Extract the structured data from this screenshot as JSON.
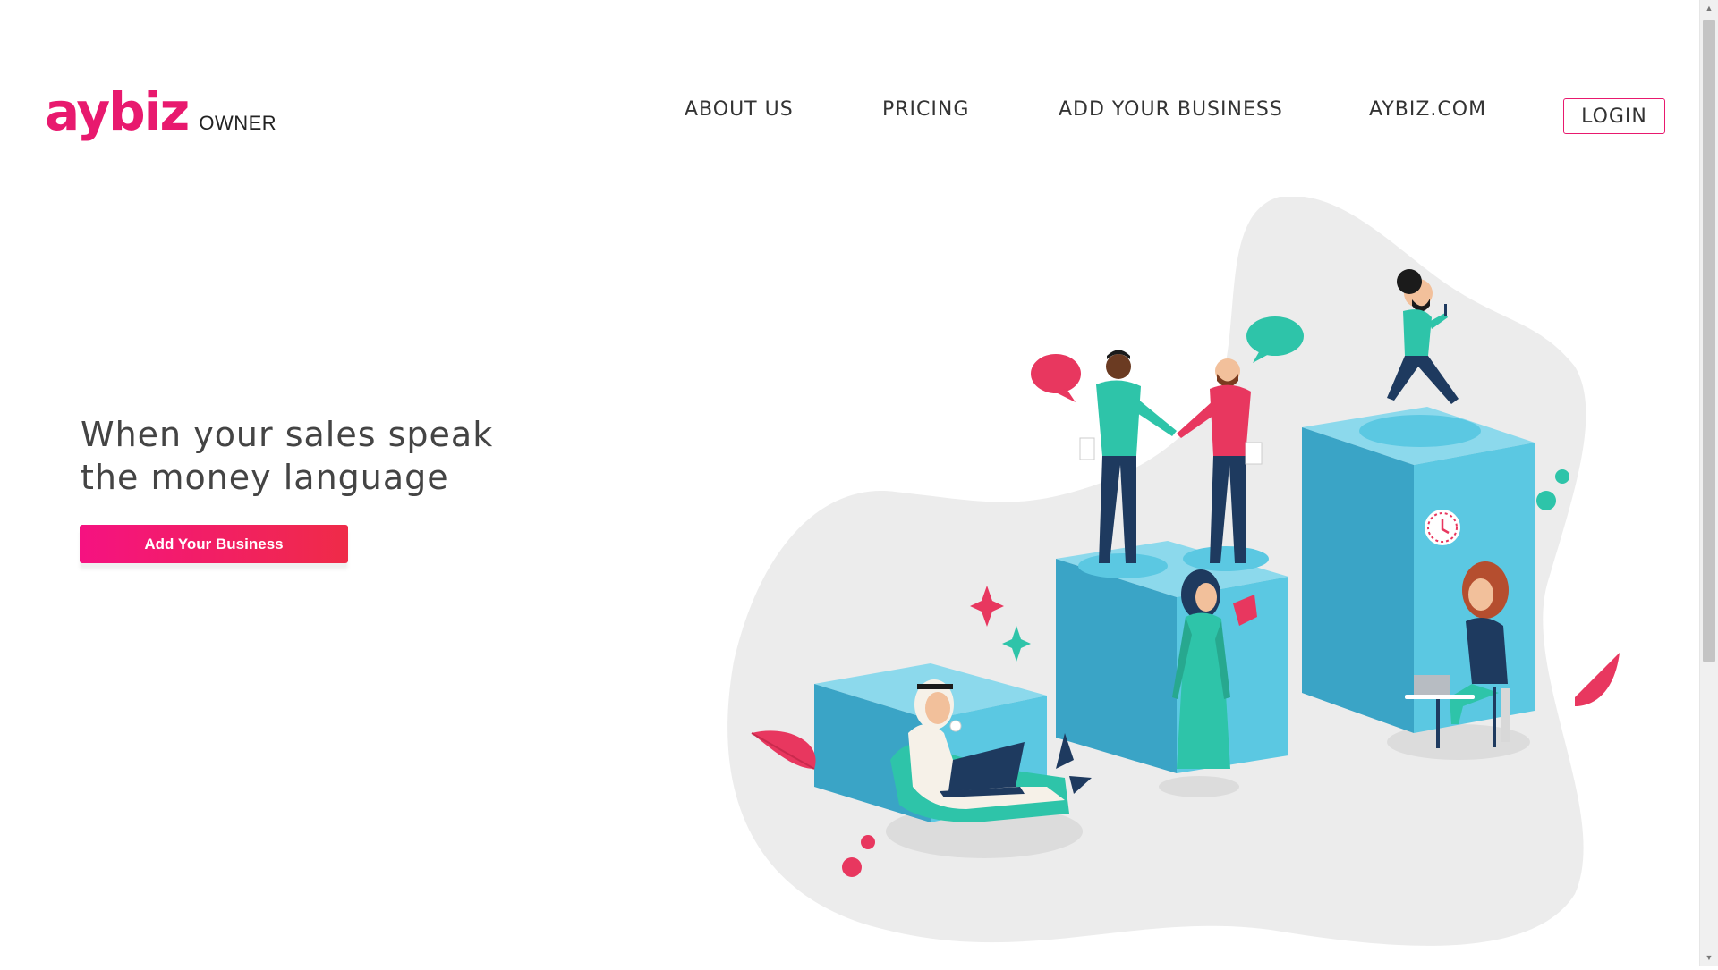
{
  "brand": {
    "logo_text": "aybiz",
    "logo_sub": "OWNER",
    "accent_color": "#e8196e"
  },
  "nav": {
    "items": [
      {
        "label": "ABOUT US"
      },
      {
        "label": "PRICING"
      },
      {
        "label": "ADD YOUR BUSINESS"
      },
      {
        "label": "AYBIZ.COM"
      }
    ],
    "login_label": "LOGIN"
  },
  "hero": {
    "title_line1": "When your sales speak",
    "title_line2": "the money language",
    "cta_label": "Add Your Business",
    "cta_gradient": [
      "#f51281",
      "#ef2b48"
    ]
  },
  "illustration": {
    "colors": {
      "blob": "#ececec",
      "teal": "#2ec4a9",
      "blue": "#5bc8e2",
      "blue_dark": "#3aa4c6",
      "pink": "#e8375f",
      "navy": "#1e3a5f"
    }
  }
}
